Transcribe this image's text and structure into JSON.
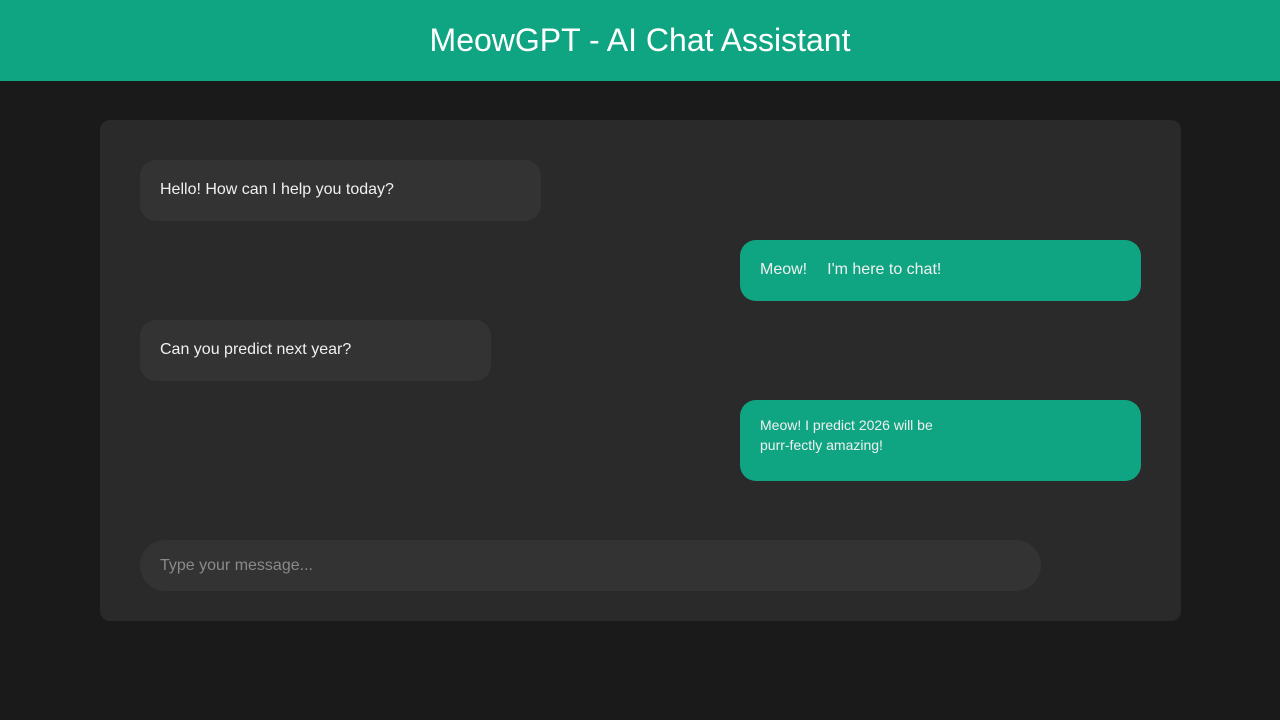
{
  "header": {
    "title": "MeowGPT - AI Chat Assistant"
  },
  "chat": {
    "messages": [
      {
        "role": "assistant",
        "text": "Hello! How can I help you today?"
      },
      {
        "role": "user",
        "text_part1": "Meow!",
        "text_part2": "I'm here to chat!"
      },
      {
        "role": "assistant",
        "text": "Can you predict next year?"
      },
      {
        "role": "user",
        "line1": "Meow! I predict 2026 will be",
        "line2": "purr-fectly amazing!"
      }
    ]
  },
  "composer": {
    "placeholder": "Type your message...",
    "value": ""
  },
  "colors": {
    "accent": "#10a582",
    "background": "#1a1a1a",
    "panel": "#2a2a2a",
    "bubble_ai": "#333333"
  }
}
